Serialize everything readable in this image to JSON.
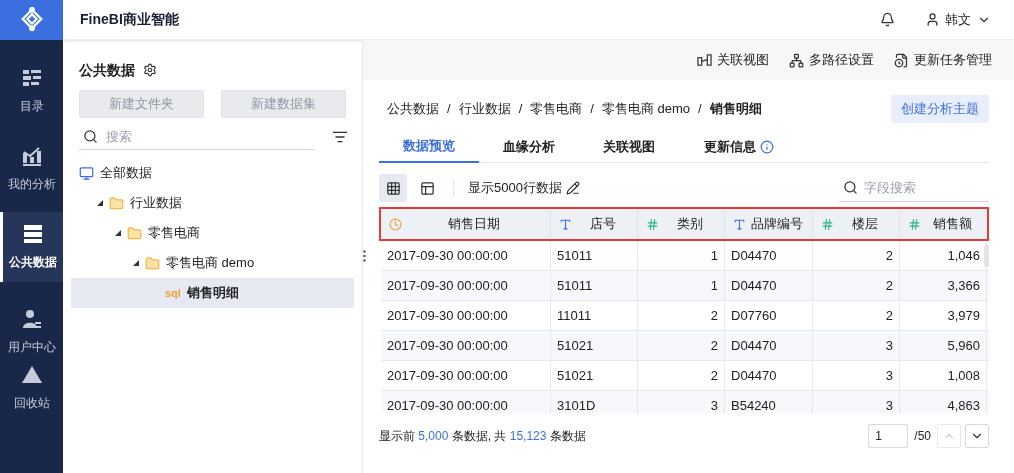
{
  "app": {
    "title": "FineBI商业智能",
    "user": "韩文"
  },
  "nav": [
    {
      "label": "目录",
      "selected": false
    },
    {
      "label": "我的分析",
      "selected": false
    },
    {
      "label": "公共数据",
      "selected": true
    },
    {
      "label": "用户中心",
      "selected": false
    },
    {
      "label": "回收站",
      "selected": false
    }
  ],
  "panel": {
    "title": "公共数据",
    "buttons": [
      {
        "label": "新建文件夹",
        "disabled": true
      },
      {
        "label": "新建数据集",
        "disabled": true
      }
    ],
    "search": {
      "placeholder": "搜索"
    },
    "tree": [
      {
        "label": "全部数据",
        "kind": "root",
        "selected": false,
        "children": [
          {
            "label": "行业数据",
            "kind": "folder",
            "selected": false,
            "expanded": true,
            "children": [
              {
                "label": "零售电商",
                "kind": "folder",
                "selected": false,
                "expanded": true,
                "children": [
                  {
                    "label": "零售电商 demo",
                    "kind": "folder",
                    "selected": false,
                    "expanded": true,
                    "children": [
                      {
                        "label": "销售明细",
                        "kind": "table",
                        "badge": "sql",
                        "selected": true
                      }
                    ]
                  }
                ]
              }
            ]
          }
        ]
      }
    ]
  },
  "toolbar": [
    {
      "label": "关联视图"
    },
    {
      "label": "多路径设置"
    },
    {
      "label": "更新任务管理"
    }
  ],
  "breadcrumb": {
    "separator": "/",
    "items": [
      "公共数据",
      "行业数据",
      "零售电商",
      "零售电商 demo",
      "销售明细"
    ]
  },
  "create_button": "创建分析主题",
  "tabs": [
    {
      "label": "数据预览",
      "selected": true,
      "info": false
    },
    {
      "label": "血缘分析",
      "selected": false,
      "info": false
    },
    {
      "label": "关联视图",
      "selected": false,
      "info": false
    },
    {
      "label": "更新信息",
      "selected": false,
      "info": true
    }
  ],
  "view_modes": [
    {
      "selected": true
    },
    {
      "selected": false
    }
  ],
  "row_limit": "显示5000行数据",
  "field_search": {
    "placeholder": "字段搜索"
  },
  "table": {
    "columns": [
      {
        "label": "销售日期",
        "kind": "date"
      },
      {
        "label": "店号",
        "kind": "text"
      },
      {
        "label": "类别",
        "kind": "number"
      },
      {
        "label": "品牌编号",
        "kind": "text"
      },
      {
        "label": "楼层",
        "kind": "number"
      },
      {
        "label": "销售额",
        "kind": "number"
      }
    ],
    "rows": [
      [
        "2017-09-30 00:00:00",
        "51011",
        "1",
        "D04470",
        "2",
        "1,046"
      ],
      [
        "2017-09-30 00:00:00",
        "51011",
        "1",
        "D04470",
        "2",
        "3,366"
      ],
      [
        "2017-09-30 00:00:00",
        "11011",
        "2",
        "D07760",
        "2",
        "3,979"
      ],
      [
        "2017-09-30 00:00:00",
        "51021",
        "2",
        "D04470",
        "3",
        "5,960"
      ],
      [
        "2017-09-30 00:00:00",
        "51021",
        "2",
        "D04470",
        "3",
        "1,008"
      ],
      [
        "2017-09-30 00:00:00",
        "3101D",
        "3",
        "B54240",
        "3",
        "4,863"
      ]
    ]
  },
  "footer": [
    {
      "text": "显示前 ",
      "kind": "plain"
    },
    {
      "text": "5,000",
      "kind": "count"
    },
    {
      "text": " 条数据, 共 ",
      "kind": "plain"
    },
    {
      "text": "15,123",
      "kind": "count"
    },
    {
      "text": " 条数据",
      "kind": "plain"
    }
  ],
  "pagination": {
    "page": "1",
    "total": "/50",
    "prev_disabled": true,
    "next_disabled": false
  }
}
